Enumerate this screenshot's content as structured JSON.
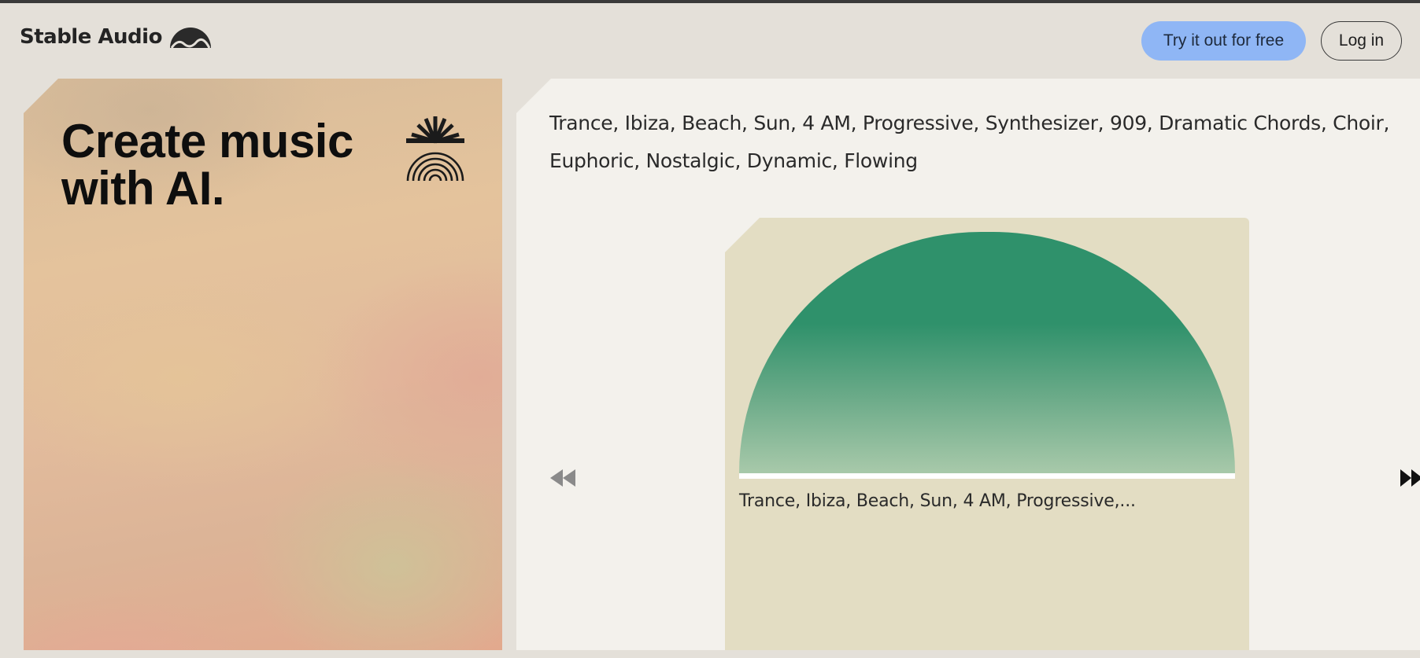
{
  "brand": {
    "name": "Stable Audio",
    "logo_icon": "mountain-wave-icon"
  },
  "header": {
    "try_label": "Try it out for free",
    "login_label": "Log in",
    "accent_color": "#8fb6f5"
  },
  "hero": {
    "title_line1": "Create music",
    "title_line2": "with AI.",
    "icon": "sunrise-rainbow-icon"
  },
  "player": {
    "prompt_text": "Trance, Ibiza, Beach, Sun, 4 AM, Progressive, Synthesizer, 909, Dramatic Chords, Choir, Euphoric, Nostalgic, Dynamic, Flowing",
    "track_label": "Trance, Ibiza, Beach, Sun, 4 AM, Progressive,...",
    "prev_icon": "rewind-icon",
    "next_icon": "fast-forward-icon",
    "artwork_color": "#2f916b"
  }
}
